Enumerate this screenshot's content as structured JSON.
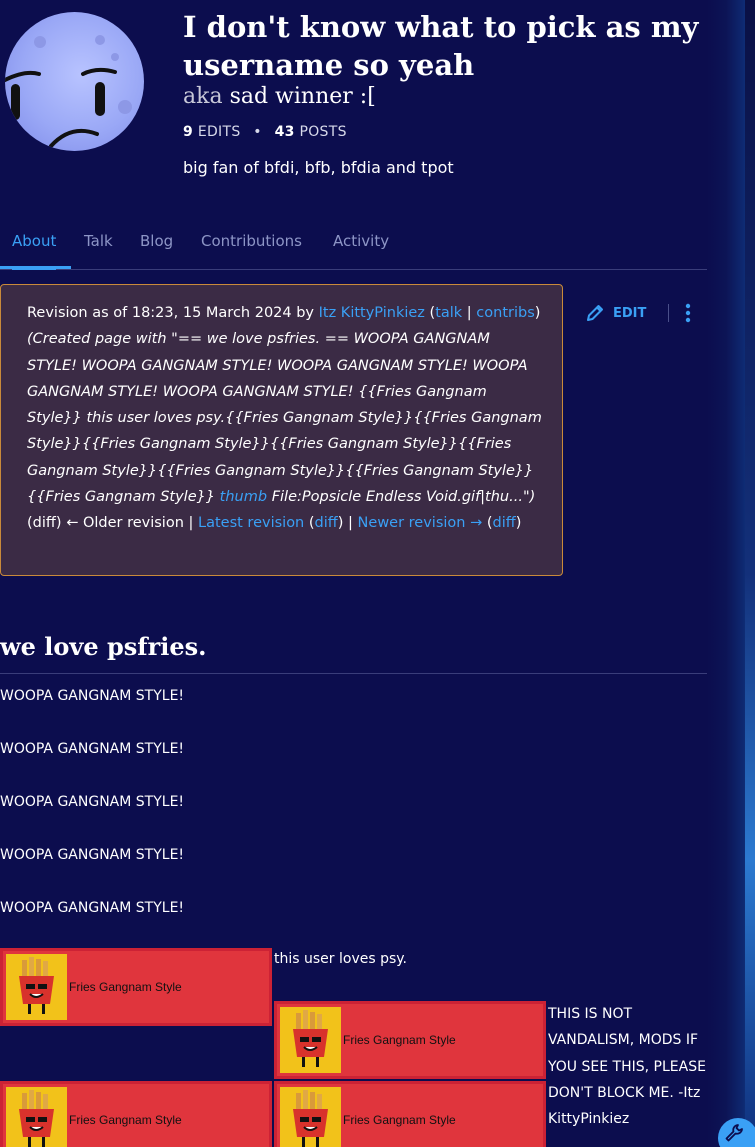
{
  "profile": {
    "username": "I don't know what to pick as my username so yeah",
    "aka_label": "aka",
    "aka_value": "sad winner :[",
    "edits_count": "9",
    "edits_label": "EDITS",
    "posts_count": "43",
    "posts_label": "POSTS",
    "bio": "big fan of bfdi, bfb, bfdia and tpot"
  },
  "tabs": [
    "About",
    "Talk",
    "Blog",
    "Contributions",
    "Activity"
  ],
  "active_tab": "About",
  "edit": {
    "label": "EDIT",
    "edit_icon": "pencil-icon",
    "more_icon": "kebab-menu-icon"
  },
  "revision": {
    "prefix": "Revision as of 18:23, 15 March 2024 by",
    "author": "Itz KittyPinkiez",
    "talk": "talk",
    "contribs": "contribs",
    "summary_a": "(Created page with \"== we love psfries. == WOOPA GANGNAM STYLE! WOOPA GANGNAM STYLE! WOOPA GANGNAM STYLE! WOOPA GANGNAM STYLE! WOOPA GANGNAM STYLE! {{Fries Gangnam Style}} this user loves psy.{{Fries Gangnam Style}}{{Fries Gangnam Style}}{{Fries Gangnam Style}}{{Fries Gangnam Style}}{{Fries Gangnam Style}}{{Fries Gangnam Style}}{{Fries Gangnam Style}}{{Fries Gangnam Style}}",
    "thumb": "thumb",
    "summary_b": "File:Popsicle Endless Void.gif|thu...\")",
    "diff": "diff",
    "older": "← Older revision",
    "latest": "Latest revision",
    "newer": "Newer revision →"
  },
  "content": {
    "section_title": "we love psfries.",
    "woopa_lines": [
      "WOOPA GANGNAM STYLE!",
      "WOOPA GANGNAM STYLE!",
      "WOOPA GANGNAM STYLE!",
      "WOOPA GANGNAM STYLE!",
      "WOOPA GANGNAM STYLE!"
    ],
    "userbox_label": "Fries Gangnam Style",
    "psy_text": "this user loves psy.",
    "note": "THIS IS NOT VANDALISM, MODS IF YOU SEE THIS, PLEASE DON'T BLOCK ME. -Itz KittyPinkiez"
  },
  "colors": {
    "background": "#0c0d4e",
    "accent": "#3aa0f5",
    "revbox_bg": "#3b2b45",
    "revbox_border": "#c98a3a",
    "userbox_bg": "#e0353d",
    "userbox_img_bg": "#f2c21a"
  },
  "icons": {
    "tools": "wrench-icon"
  }
}
